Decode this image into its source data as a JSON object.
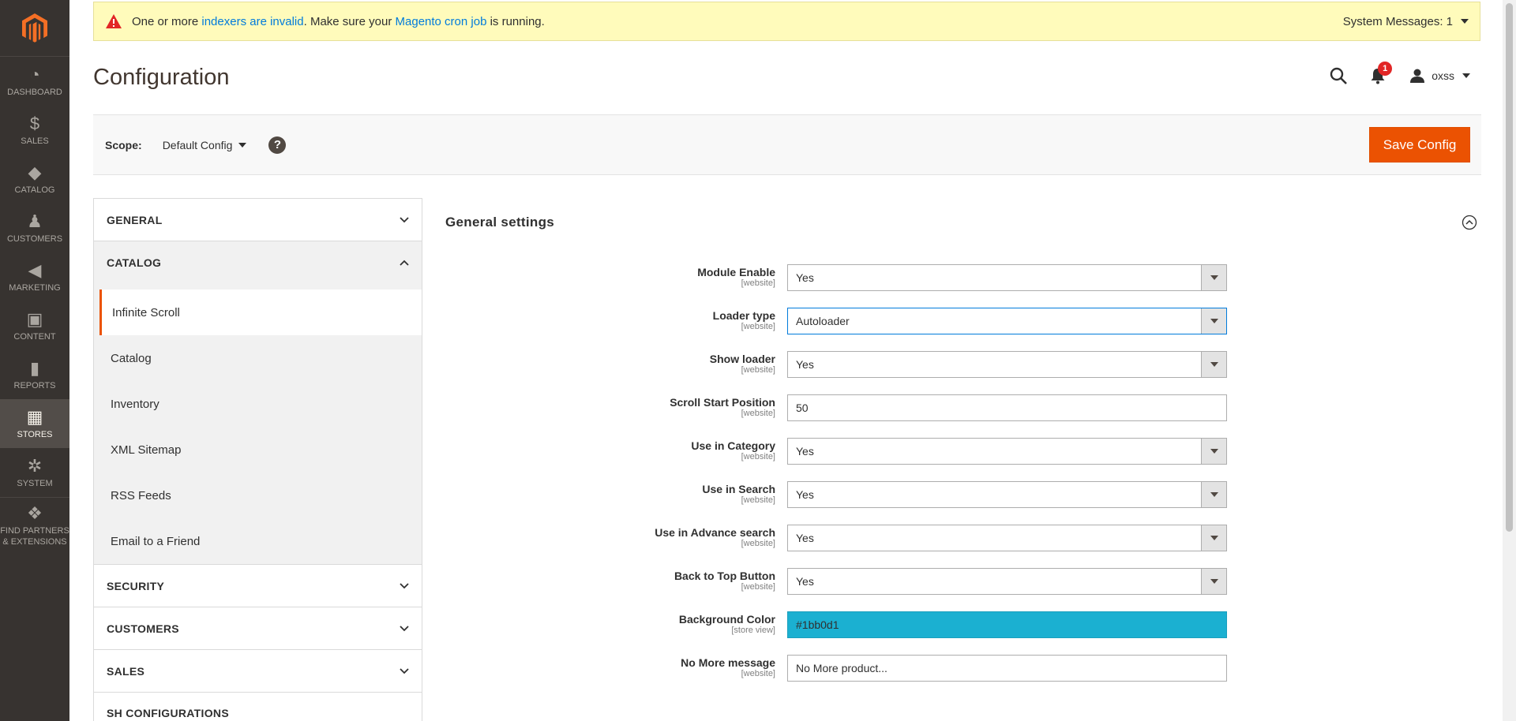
{
  "nav": {
    "items": [
      {
        "label": "DASHBOARD",
        "icon": "dashboard-icon",
        "glyph": "◔"
      },
      {
        "label": "SALES",
        "icon": "dollar-icon",
        "glyph": "$"
      },
      {
        "label": "CATALOG",
        "icon": "cube-icon",
        "glyph": "◆"
      },
      {
        "label": "CUSTOMERS",
        "icon": "person-icon",
        "glyph": "♟"
      },
      {
        "label": "MARKETING",
        "icon": "megaphone-icon",
        "glyph": "◀"
      },
      {
        "label": "CONTENT",
        "icon": "layout-icon",
        "glyph": "▣"
      },
      {
        "label": "REPORTS",
        "icon": "bar-chart-icon",
        "glyph": "▮"
      },
      {
        "label": "STORES",
        "icon": "store-icon",
        "glyph": "▦"
      },
      {
        "label": "SYSTEM",
        "icon": "gear-icon",
        "glyph": "✲"
      },
      {
        "label": "FIND PARTNERS & EXTENSIONS",
        "icon": "boxes-icon",
        "glyph": "❖"
      }
    ]
  },
  "system_message": {
    "text_1": "One or more ",
    "link_1": "indexers are invalid",
    "text_2": ". Make sure your ",
    "link_2": "Magento cron job",
    "text_3": " is running.",
    "counter": "System Messages: 1"
  },
  "header": {
    "title": "Configuration",
    "notification_count": "1",
    "username": "oxss"
  },
  "scope": {
    "label": "Scope:",
    "value": "Default Config",
    "help": "?",
    "save_label": "Save Config"
  },
  "tabs": {
    "general": "GENERAL",
    "catalog": "CATALOG",
    "catalog_items": [
      "Infinite Scroll",
      "Catalog",
      "Inventory",
      "XML Sitemap",
      "RSS Feeds",
      "Email to a Friend"
    ],
    "security": "SECURITY",
    "customers": "CUSTOMERS",
    "sales": "SALES",
    "more": "SH CONFIGURATIONS"
  },
  "section": {
    "title": "General settings",
    "fields": [
      {
        "label": "Module Enable",
        "scope": "[website]",
        "value": "Yes",
        "type": "select"
      },
      {
        "label": "Loader type",
        "scope": "[website]",
        "value": "Autoloader",
        "type": "select"
      },
      {
        "label": "Show loader",
        "scope": "[website]",
        "value": "Yes",
        "type": "select"
      },
      {
        "label": "Scroll Start Position",
        "scope": "[website]",
        "value": "50",
        "type": "text"
      },
      {
        "label": "Use in Category",
        "scope": "[website]",
        "value": "Yes",
        "type": "select"
      },
      {
        "label": "Use in Search",
        "scope": "[website]",
        "value": "Yes",
        "type": "select"
      },
      {
        "label": "Use in Advance search",
        "scope": "[website]",
        "value": "Yes",
        "type": "select"
      },
      {
        "label": "Back to Top Button",
        "scope": "[website]",
        "value": "Yes",
        "type": "select"
      },
      {
        "label": "Background Color",
        "scope": "[store view]",
        "value": "#1bb0d1",
        "type": "color"
      },
      {
        "label": "No More message",
        "scope": "[website]",
        "value": "No More product...",
        "type": "text"
      }
    ]
  },
  "colors": {
    "accent": "#eb5202",
    "nav_bg": "#373330",
    "link": "#007bdb",
    "background_color_value": "#1bb0d1"
  }
}
